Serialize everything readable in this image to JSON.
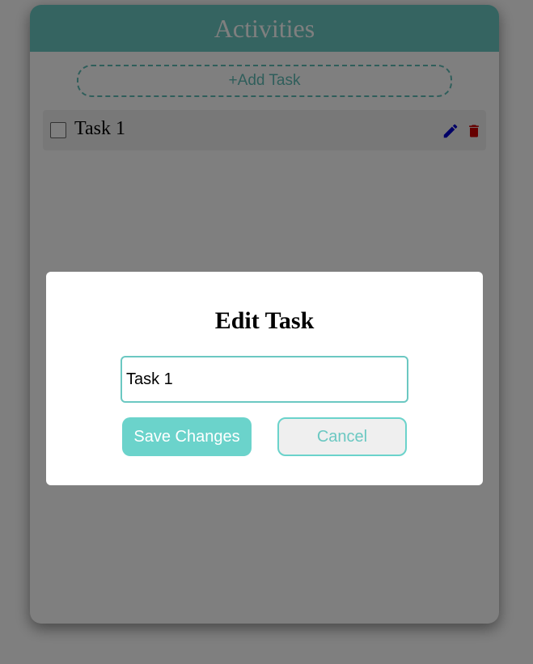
{
  "header": {
    "title": "Activities"
  },
  "add_task": {
    "label": "+Add Task"
  },
  "tasks": [
    {
      "label": "Task 1",
      "checked": false
    }
  ],
  "modal": {
    "title": "Edit Task",
    "input_value": "Task 1",
    "save_label": "Save Changes",
    "cancel_label": "Cancel"
  },
  "icons": {
    "edit": "pencil-icon",
    "delete": "trash-icon"
  },
  "colors": {
    "accent": "#6bc8c2",
    "edit_icon": "#0000cc",
    "delete_icon": "#cc0000"
  }
}
